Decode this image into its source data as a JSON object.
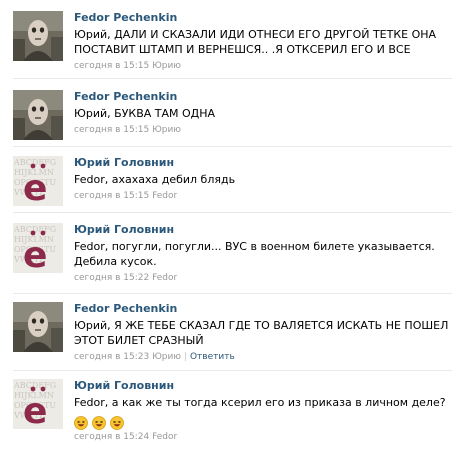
{
  "posts": [
    {
      "author": "Fedor Pechenkin",
      "avatar": "fedor-avatar",
      "lines": [
        "Юрий, ДАЛИ И СКАЗАЛИ ИДИ ОТНЕСИ ЕГО ДРУГОЙ ТЕТКЕ ОНА",
        "ПОСТАВИТ ШТАМП И ВЕРНЕШСЯ.. .Я ОТКСЕРИЛ ЕГО И ВСЕ"
      ],
      "meta": "сегодня в 15:15 Юрию"
    },
    {
      "author": "Fedor Pechenkin",
      "avatar": "fedor-avatar",
      "lines": [
        "Юрий, БУКВА ТАМ ОДНА"
      ],
      "meta": "сегодня в 15:15 Юрию"
    },
    {
      "author": "Юрий Головнин",
      "avatar": "yuri-avatar",
      "lines": [
        "Fedor, ахахаха дебил блядь"
      ],
      "meta": "сегодня в 15:15 Fedor"
    },
    {
      "author": "Юрий Головнин",
      "avatar": "yuri-avatar",
      "lines": [
        "Fedor, погугли, погугли... ВУС в военном билете указывается.",
        "Дебила кусок."
      ],
      "meta": "сегодня в 15:22 Fedor"
    },
    {
      "author": "Fedor Pechenkin",
      "avatar": "fedor-avatar",
      "lines": [
        "Юрий, Я ЖЕ ТЕБЕ СКАЗАЛ ГДЕ ТО ВАЛЯЕТСЯ ИСКАТЬ НЕ ПОШЕЛ",
        "ЭТОТ БИЛЕТ СРАЗНЫЙ"
      ],
      "meta": "сегодня в 15:23 Юрию",
      "reply": "Ответить"
    },
    {
      "author": "Юрий Головнин",
      "avatar": "yuri-avatar",
      "lines": [
        "Fedor, а как же ты тогда ксерил его из приказа в личном деле?"
      ],
      "emoji": [
        "laughing-emoji",
        "laughing-emoji",
        "laughing-emoji"
      ],
      "meta": "сегодня в 15:24 Fedor"
    }
  ],
  "colors": {
    "author_link": "#2b587a",
    "meta_text": "#999999",
    "divider": "#e7eaed",
    "emoji_yellow": "#f7c531"
  }
}
